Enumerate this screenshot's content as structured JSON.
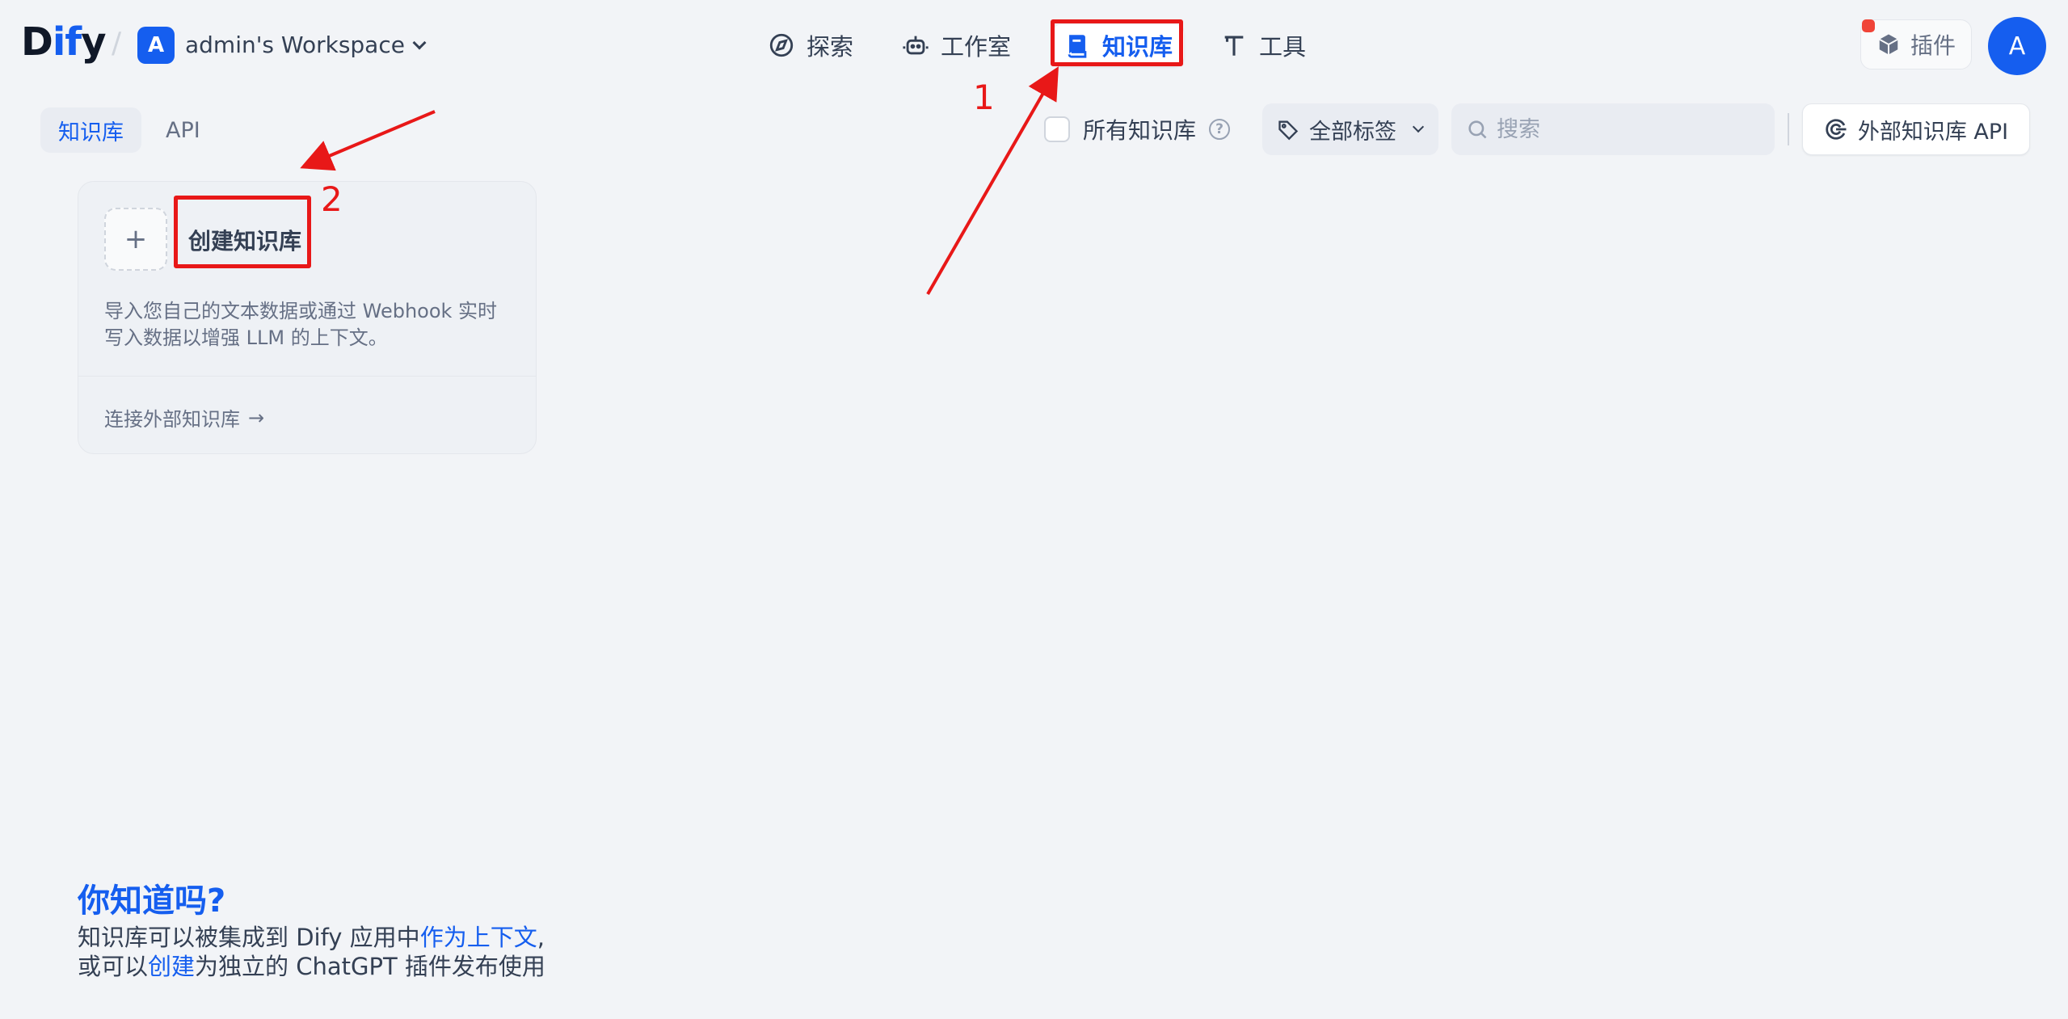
{
  "header": {
    "logo": {
      "part1": "D",
      "part2": "if",
      "part3": "y"
    },
    "workspace": {
      "avatar_letter": "A",
      "name": "admin's Workspace"
    },
    "nav": [
      {
        "label": "探索",
        "icon": "compass-icon"
      },
      {
        "label": "工作室",
        "icon": "robot-icon"
      },
      {
        "label": "知识库",
        "icon": "book-icon",
        "active": true
      },
      {
        "label": "工具",
        "icon": "hammer-icon"
      }
    ],
    "plugins_label": "插件",
    "user_avatar_letter": "A"
  },
  "subnav": {
    "tabs": [
      {
        "label": "知识库",
        "active": true
      },
      {
        "label": "API"
      }
    ]
  },
  "filters": {
    "all_kb_label": "所有知识库",
    "help_glyph": "?",
    "tags_label": "全部标签",
    "search_placeholder": "搜索",
    "external_api_label": "外部知识库 API"
  },
  "create_card": {
    "plus": "+",
    "title": "创建知识库",
    "description": "导入您自己的文本数据或通过 Webhook 实时写入数据以增强 LLM 的上下文。",
    "connect_link": "连接外部知识库",
    "connect_arrow": "→"
  },
  "annotations": {
    "step1": "1",
    "step2": "2"
  },
  "tip": {
    "title": "你知道吗?",
    "line1_a": "知识库可以被集成到 Dify 应用中",
    "line1_link": "作为上下文",
    "line1_b": ",",
    "line2_a": "或可以",
    "line2_link": "创建",
    "line2_b": "为独立的 ChatGPT 插件发布使用"
  },
  "colors": {
    "accent": "#155eef",
    "background": "#f2f4f7",
    "annotation_red": "#e81818"
  }
}
